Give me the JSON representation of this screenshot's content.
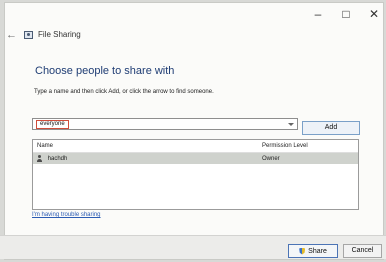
{
  "window": {
    "title": "File Sharing",
    "controls": {
      "minimize": "–",
      "maximize": "□",
      "close": "✕"
    }
  },
  "nav": {
    "back_arrow": "←"
  },
  "content": {
    "heading": "Choose people to share with",
    "instruction": "Type a name and then click Add, or click the arrow to find someone.",
    "input_value": "everyone",
    "add_label": "Add",
    "table": {
      "headers": [
        "Name",
        "Permission Level"
      ],
      "rows": [
        {
          "name": "hachdh",
          "permission": "Owner"
        }
      ]
    },
    "trouble_link": "I'm having trouble sharing"
  },
  "footer": {
    "share_label": "Share",
    "cancel_label": "Cancel"
  },
  "icons": {
    "file_sharing": "share-icon",
    "dropdown": "chevron-down-icon",
    "user": "user-icon",
    "share_shield": "shield-icon"
  },
  "colors": {
    "heading": "#1f3d74",
    "link": "#2b5bb3",
    "selected_row": "#cfd2cd",
    "input_highlight": "#d04d3a"
  }
}
